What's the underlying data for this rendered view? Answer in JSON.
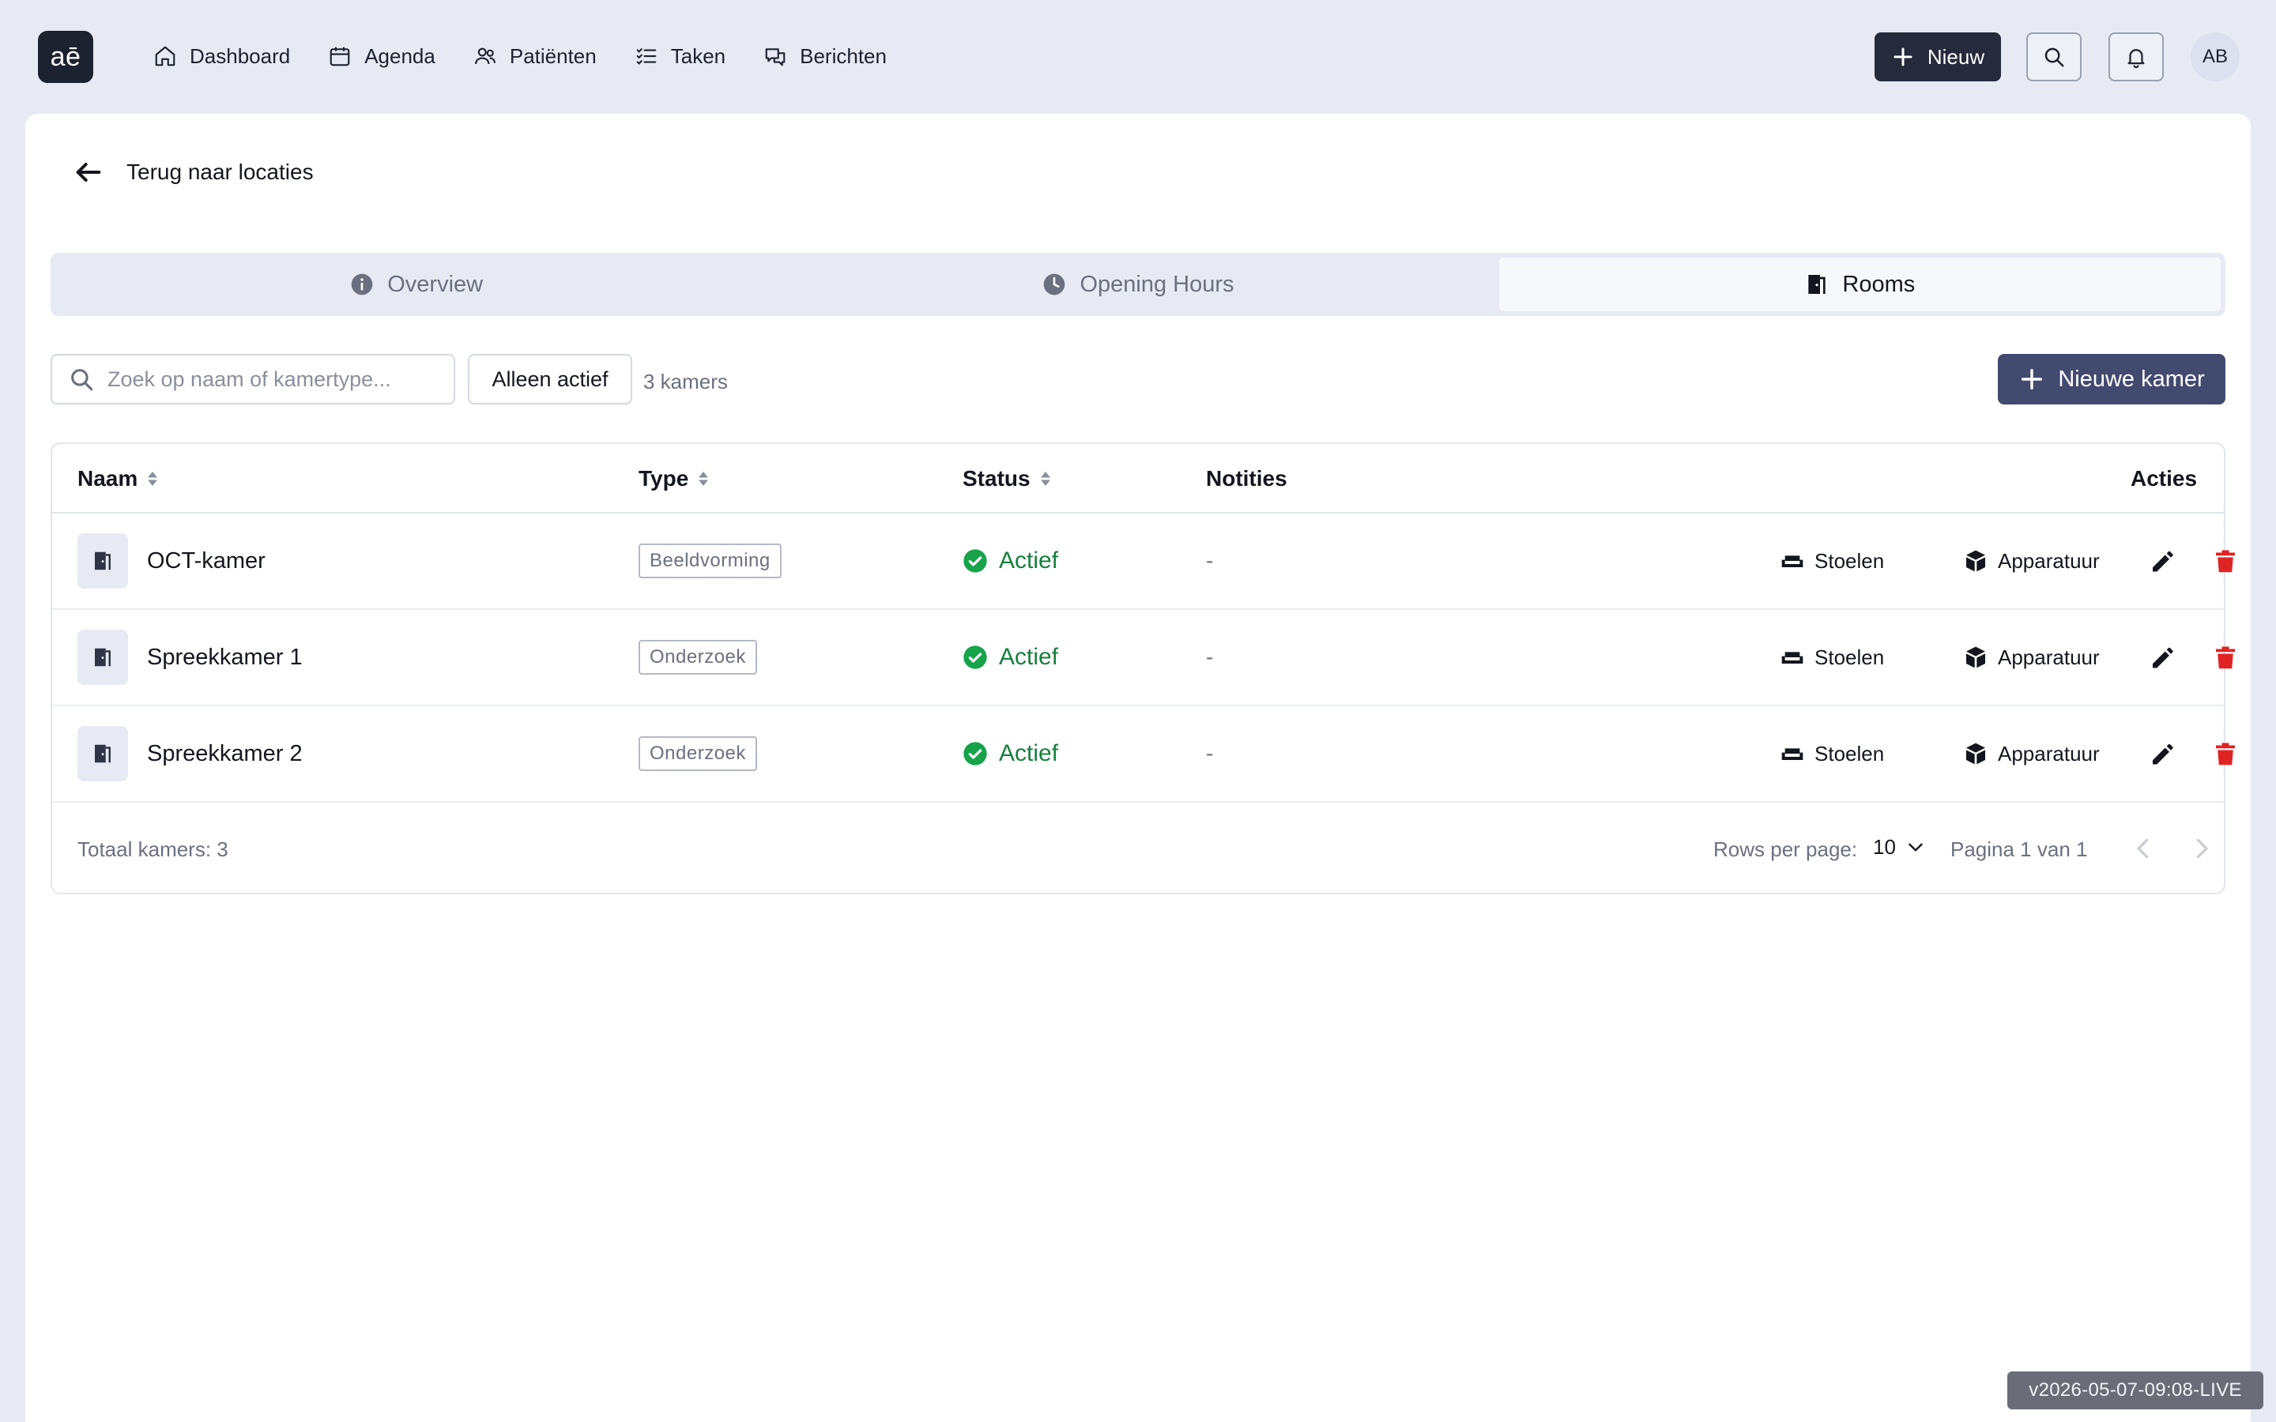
{
  "app": {
    "logo_text": "aē"
  },
  "nav": {
    "items": [
      {
        "label": "Dashboard",
        "icon": "home-icon"
      },
      {
        "label": "Agenda",
        "icon": "calendar-icon"
      },
      {
        "label": "Patiënten",
        "icon": "users-icon"
      },
      {
        "label": "Taken",
        "icon": "tasks-icon"
      },
      {
        "label": "Berichten",
        "icon": "messages-icon"
      }
    ],
    "new_button": "Nieuw",
    "avatar_initials": "AB"
  },
  "back_link": "Terug naar locaties",
  "tabs": [
    {
      "label": "Overview",
      "icon": "info-icon",
      "active": false
    },
    {
      "label": "Opening Hours",
      "icon": "clock-icon",
      "active": false
    },
    {
      "label": "Rooms",
      "icon": "door-icon",
      "active": true
    }
  ],
  "toolbar": {
    "search_placeholder": "Zoek op naam of kamertype...",
    "filter_label": "Alleen actief",
    "count_text": "3 kamers",
    "add_button": "Nieuwe kamer"
  },
  "table": {
    "headers": {
      "name": "Naam",
      "type": "Type",
      "status": "Status",
      "notes": "Notities",
      "actions": "Acties"
    },
    "rows": [
      {
        "name": "OCT-kamer",
        "type": "Beeldvorming",
        "status": "Actief",
        "notes": "-",
        "chairs": "Stoelen",
        "equipment": "Apparatuur"
      },
      {
        "name": "Spreekkamer 1",
        "type": "Onderzoek",
        "status": "Actief",
        "notes": "-",
        "chairs": "Stoelen",
        "equipment": "Apparatuur"
      },
      {
        "name": "Spreekkamer 2",
        "type": "Onderzoek",
        "status": "Actief",
        "notes": "-",
        "chairs": "Stoelen",
        "equipment": "Apparatuur"
      }
    ],
    "footer": {
      "total": "Totaal kamers: 3",
      "rows_per_page_label": "Rows per page:",
      "rows_per_page_value": "10",
      "page_text": "Pagina 1 van 1"
    }
  },
  "version": "v2026-05-07-09:08-LIVE",
  "colors": {
    "accent": "#434a70",
    "dark": "#262b3c",
    "success": "#16a34a",
    "danger": "#e02424",
    "background": "#e8eaf3"
  }
}
